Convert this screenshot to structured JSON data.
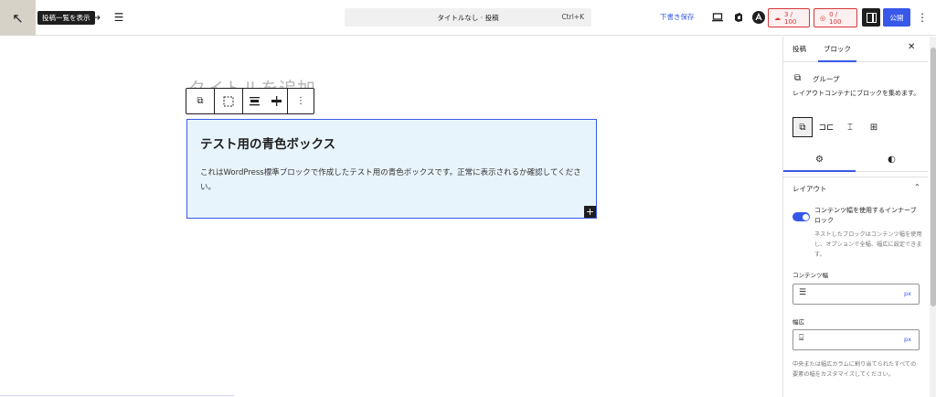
{
  "topbar": {
    "tooltip": "投稿一覧を表示",
    "command_title": "タイトルなし · 投稿",
    "command_shortcut": "Ctrl+K",
    "save_draft": "下書き保存",
    "badge_a": "3 / 100",
    "badge_b": "0 / 100",
    "publish": "公開"
  },
  "editor": {
    "title_placeholder": "タイトルを追加",
    "heading": "テスト用の青色ボックス",
    "paragraph": "これはWordPress標準ブロックで作成したテスト用の青色ボックスです。正常に表示されるか確認してください。"
  },
  "sidebar": {
    "tab_post": "投稿",
    "tab_block": "ブロック",
    "block_name": "グループ",
    "block_description": "レイアウトコンテナにブロックを集めます。",
    "layout_panel_title": "レイアウト",
    "toggle_label": "コンテンツ幅を使用するインナーブロック",
    "toggle_help": "ネストしたブロックはコンテンツ幅を使用し、オプションで全幅、幅広に設定できます。",
    "content_width_label": "コンテンツ幅",
    "wide_width_label": "幅広",
    "unit": "px",
    "bottom_help": "中央または幅広カラムに割り当てられたすべての要素の幅をカスタマイズしてください。"
  }
}
